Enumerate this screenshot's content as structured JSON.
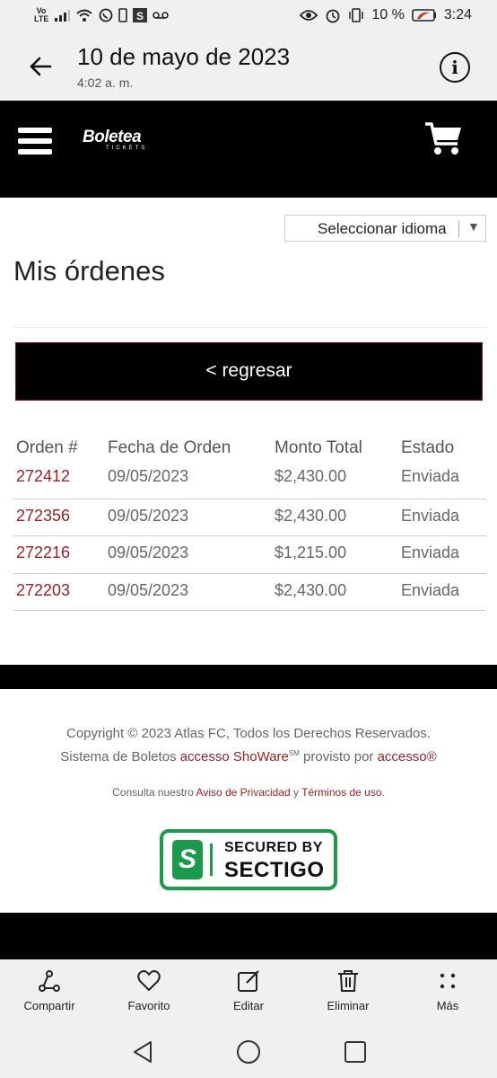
{
  "status_bar": {
    "network": "Vo LTE",
    "battery": "10 %",
    "time": "3:24"
  },
  "gallery_header": {
    "date": "10 de mayo de 2023",
    "time": "4:02 a. m."
  },
  "site": {
    "logo_text": "Boletea",
    "logo_sub": "TICKETS"
  },
  "language_select": {
    "selected": "Seleccionar idioma"
  },
  "page_title": "Mis órdenes",
  "back_button": "< regresar",
  "orders": {
    "headers": [
      "Orden #",
      "Fecha de Orden",
      "Monto Total",
      "Estado"
    ],
    "rows": [
      {
        "order": "272412",
        "date": "09/05/2023",
        "total": "$2,430.00",
        "status": "Enviada"
      },
      {
        "order": "272356",
        "date": "09/05/2023",
        "total": "$2,430.00",
        "status": "Enviada"
      },
      {
        "order": "272216",
        "date": "09/05/2023",
        "total": "$1,215.00",
        "status": "Enviada"
      },
      {
        "order": "272203",
        "date": "09/05/2023",
        "total": "$2,430.00",
        "status": "Enviada"
      }
    ]
  },
  "footer": {
    "copyright": "Copyright © 2023 Atlas FC, Todos los Derechos Reservados.",
    "system_prefix": "Sistema de Boletos ",
    "showare": "accesso ShoWare",
    "sm": "SM",
    "provided_by": " provisto por ",
    "accesso": "accesso®",
    "consult": "Consulta nuestro ",
    "privacy": "Aviso de Privacidad",
    "and": " y ",
    "terms": "Términos de uso",
    "period": ".",
    "seal_line1": "SECURED BY",
    "seal_line2": "SECTIGO"
  },
  "toolbar": {
    "share": "Compartir",
    "favorite": "Favorito",
    "edit": "Editar",
    "delete": "Eliminar",
    "more": "Más"
  },
  "colors": {
    "link_red": "#9a1f1f",
    "sectigo_green": "#1a9a4a"
  }
}
